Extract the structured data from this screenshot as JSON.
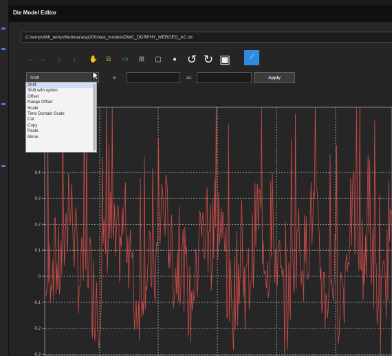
{
  "window": {
    "title": "Die Model Editor"
  },
  "file": {
    "path": "C:\\temp\\AMI_temp\\Webinar\\esp200x\\asi_models\\DWC_DDRPHY_MERGED_AC.txt"
  },
  "toolbar": {
    "buttons": [
      {
        "icon": "arrow-left-right-icon",
        "glyph": "↔",
        "color": "#2f6fd6"
      },
      {
        "icon": "arrow-left-right-alt-icon",
        "glyph": "↔",
        "color": "#2f6fd6"
      },
      {
        "icon": "arrow-up-down-icon",
        "glyph": "↕",
        "color": "#2f6fd6"
      },
      {
        "icon": "arrow-up-down-alt-icon",
        "glyph": "↕",
        "color": "#2f6fd6"
      },
      {
        "icon": "hand-pan-icon",
        "glyph": "✋",
        "color": "#cfcfcf"
      },
      {
        "icon": "copy-icon",
        "glyph": "⧉",
        "color": "#7cc242"
      },
      {
        "icon": "rectangle-select-icon",
        "glyph": "▭",
        "color": "#3fa9b0"
      },
      {
        "icon": "grid-icon",
        "glyph": "⊞",
        "color": "#bbbbbb"
      },
      {
        "icon": "fit-view-icon",
        "glyph": "▢",
        "color": "#cccccc"
      },
      {
        "icon": "eye-icon",
        "glyph": "●",
        "color": "#dddddd"
      },
      {
        "icon": "undo-icon",
        "glyph": "↺",
        "color": "#f0f0f0"
      },
      {
        "icon": "redo-icon",
        "glyph": "↻",
        "color": "#f0f0f0"
      },
      {
        "icon": "save-icon",
        "glyph": "▣",
        "color": "#f0f0f0"
      },
      {
        "icon": "select-tool-icon",
        "glyph": "⟋",
        "color": "#ffffff"
      }
    ]
  },
  "operation": {
    "selected": "Shift",
    "to_label": "to",
    "delta_label": "Δs:",
    "apply_label": "Apply",
    "options": [
      "Shift",
      "Shift with option",
      "Offset",
      "Range Offset",
      "Scale",
      "Time Domain Scale",
      "Cut",
      "Copy",
      "Paste",
      "Mirror"
    ]
  },
  "chart_data": {
    "type": "line",
    "y_tick_labels": [
      "0.4",
      "0.3",
      "0.2",
      "0.1",
      "0",
      "-0.1",
      "-0.2",
      "-0.3"
    ],
    "ylim": [
      -0.32,
      0.65
    ],
    "grid": true,
    "series": [
      {
        "values": [],
        "color": "#e0524f"
      }
    ]
  }
}
